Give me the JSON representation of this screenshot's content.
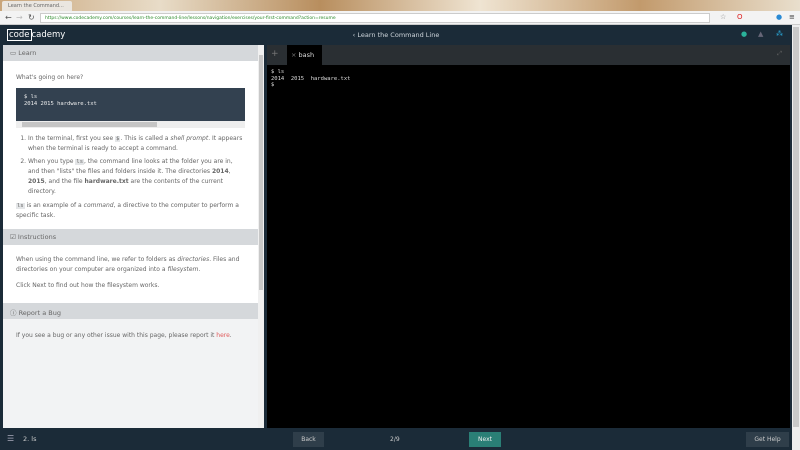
{
  "browser": {
    "tab_title": "Learn the Command...",
    "url": "https://www.codecademy.com/courses/learn-the-command-line/lessons/navigation/exercises/your-first-command?action=resume"
  },
  "header": {
    "logo_box": "code",
    "logo_rest": "cademy",
    "title": "‹ Learn the Command Line"
  },
  "learn": {
    "heading": "Learn",
    "intro": "What's going on here?",
    "code_line1": "$ ls",
    "code_line2": "2014  2015  hardware.txt",
    "item1_a": "In the terminal, first you see ",
    "item1_code": "$",
    "item1_b": ". This is called a ",
    "item1_em": "shell prompt",
    "item1_c": ". It appears when the terminal is ready to accept a command.",
    "item2_a": "When you type ",
    "item2_code": "ls",
    "item2_b": ", the command line looks at the folder you are in, and then \"lists\" the files and folders inside it. The directories ",
    "item2_d1": "2014",
    "item2_sep": ", ",
    "item2_d2": "2015",
    "item2_c": ", and the file ",
    "item2_f": "hardware.txt",
    "item2_d": " are the contents of the current directory.",
    "para_code": "ls",
    "para_a": " is an example of a ",
    "para_em": "command",
    "para_b": ", a directive to the computer to perform a specific task."
  },
  "instructions": {
    "heading": "Instructions",
    "p1_a": "When using the command line, we refer to folders as ",
    "p1_em": "directories",
    "p1_b": ". Files and directories on your computer are organized into a ",
    "p1_em2": "filesystem",
    "p1_c": ".",
    "p2": "Click Next to find out how the filesystem works."
  },
  "bug": {
    "heading": "Report a Bug",
    "text": "If you see a bug or any other issue with this page, please report it ",
    "link": "here",
    "end": "."
  },
  "terminal": {
    "tab": "bash",
    "output": "$ ls\n2014  2015  hardware.txt\n$"
  },
  "footer": {
    "lesson": "2. ls",
    "back": "Back",
    "progress": "2/9",
    "next": "Next",
    "help": "Get Help"
  },
  "colors": {
    "accent": "#2a7f76",
    "nav": "#1b2b38",
    "link": "#e05a5a"
  }
}
